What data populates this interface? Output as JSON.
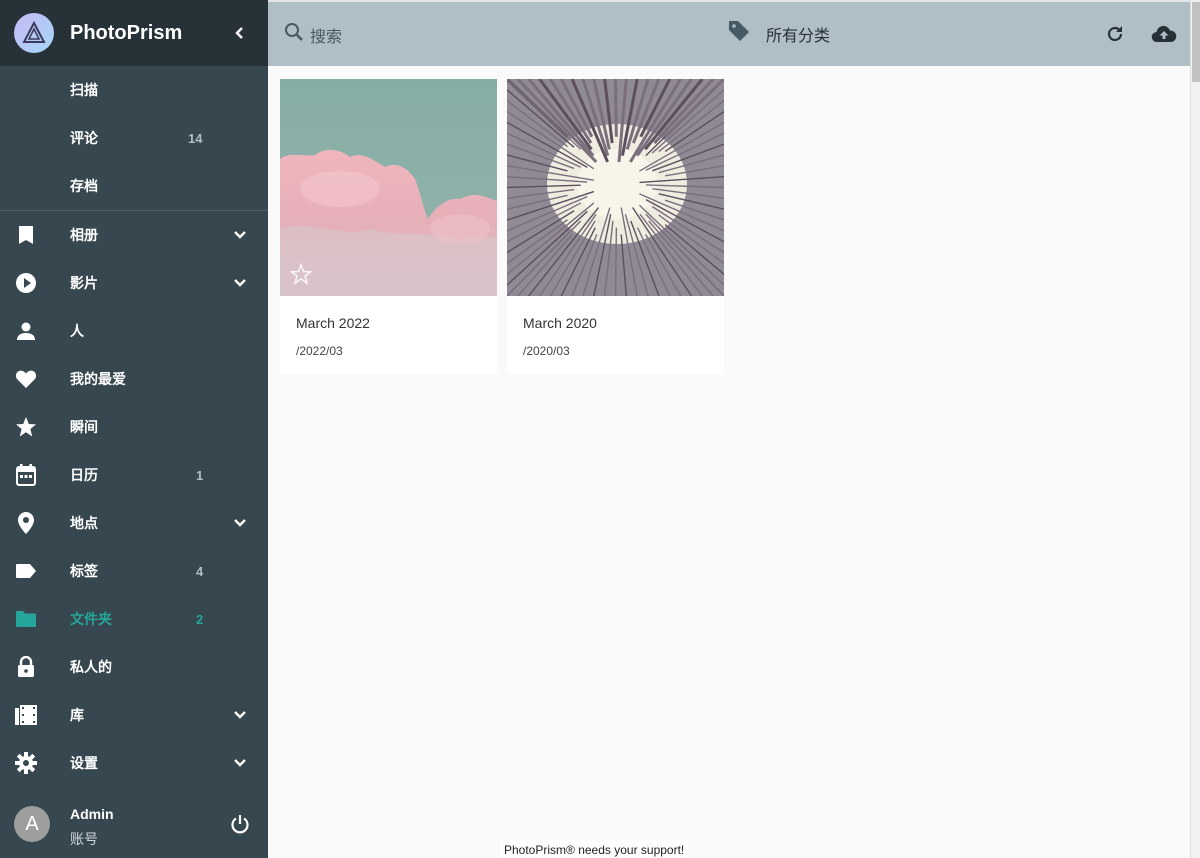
{
  "app": {
    "title": "PhotoPrism"
  },
  "sidebar": {
    "sub_items": [
      {
        "label": "扫描",
        "count": ""
      },
      {
        "label": "评论",
        "count": "14"
      },
      {
        "label": "存档",
        "count": ""
      }
    ],
    "items": [
      {
        "label": "相册",
        "icon": "bookmark-icon",
        "count": "",
        "expandable": true
      },
      {
        "label": "影片",
        "icon": "play-circle-icon",
        "count": "",
        "expandable": true
      },
      {
        "label": "人",
        "icon": "person-icon",
        "count": "",
        "expandable": false
      },
      {
        "label": "我的最爱",
        "icon": "heart-icon",
        "count": "",
        "expandable": false
      },
      {
        "label": "瞬间",
        "icon": "star-icon",
        "count": "",
        "expandable": false
      },
      {
        "label": "日历",
        "icon": "calendar-icon",
        "count": "1",
        "expandable": false
      },
      {
        "label": "地点",
        "icon": "map-marker-icon",
        "count": "",
        "expandable": true
      },
      {
        "label": "标签",
        "icon": "label-icon",
        "count": "4",
        "expandable": false
      },
      {
        "label": "文件夹",
        "icon": "folder-icon",
        "count": "2",
        "expandable": false,
        "active": true
      },
      {
        "label": "私人的",
        "icon": "lock-icon",
        "count": "",
        "expandable": false
      },
      {
        "label": "库",
        "icon": "film-library-icon",
        "count": "",
        "expandable": true
      },
      {
        "label": "设置",
        "icon": "gear-icon",
        "count": "",
        "expandable": true
      }
    ],
    "user": {
      "avatar_letter": "A",
      "name": "Admin",
      "role": "账号"
    }
  },
  "toolbar": {
    "search_placeholder": "搜索",
    "category_label": "所有分类"
  },
  "folders": [
    {
      "title": "March 2022",
      "path": "/2022/03",
      "image": "pink-clouds-photo"
    },
    {
      "title": "March 2020",
      "path": "/2020/03",
      "image": "tree-canopy-photo"
    }
  ],
  "footer": {
    "support_text": "PhotoPrism® needs your support!"
  },
  "colors": {
    "sidebar": "#37474f",
    "sidebar_header": "#263238",
    "toolbar": "#b0bec5",
    "accent": "#26a69a"
  }
}
